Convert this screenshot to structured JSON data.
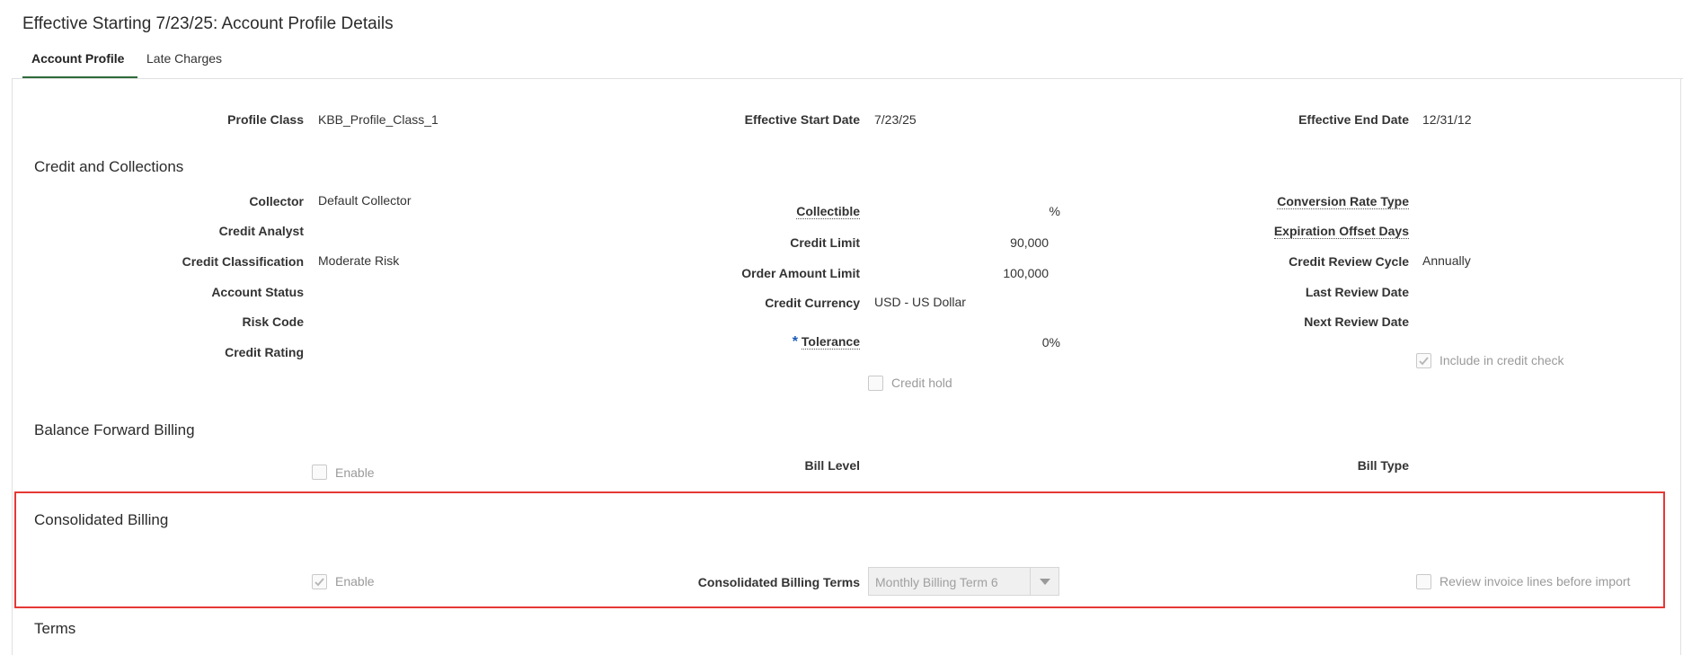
{
  "page": {
    "title": "Effective Starting 7/23/25: Account Profile Details"
  },
  "tabs": [
    {
      "label": "Account Profile",
      "active": true
    },
    {
      "label": "Late Charges",
      "active": false
    }
  ],
  "header_fields": {
    "profile_class_label": "Profile Class",
    "profile_class_value": "KBB_Profile_Class_1",
    "effective_start_label": "Effective Start Date",
    "effective_start_value": "7/23/25",
    "effective_end_label": "Effective End Date",
    "effective_end_value": "12/31/12"
  },
  "credit": {
    "title": "Credit and Collections",
    "collector_label": "Collector",
    "collector_value": "Default Collector",
    "credit_analyst_label": "Credit Analyst",
    "credit_classification_label": "Credit Classification",
    "credit_classification_value": "Moderate Risk",
    "account_status_label": "Account Status",
    "risk_code_label": "Risk Code",
    "credit_rating_label": "Credit Rating",
    "collectible_label": "Collectible",
    "collectible_value": "%",
    "credit_limit_label": "Credit Limit",
    "credit_limit_value": "90,000",
    "order_amount_limit_label": "Order Amount Limit",
    "order_amount_limit_value": "100,000",
    "credit_currency_label": "Credit Currency",
    "credit_currency_value": "USD - US Dollar",
    "tolerance_required": "*",
    "tolerance_label": "Tolerance",
    "tolerance_value": "0%",
    "credit_hold_label": "Credit hold",
    "conversion_rate_type_label": "Conversion Rate Type",
    "expiration_offset_days_label": "Expiration Offset Days",
    "credit_review_cycle_label": "Credit Review Cycle",
    "credit_review_cycle_value": "Annually",
    "last_review_date_label": "Last Review Date",
    "next_review_date_label": "Next Review Date",
    "include_credit_check_label": "Include in credit check"
  },
  "balance_forward": {
    "title": "Balance Forward Billing",
    "enable_label": "Enable",
    "bill_level_label": "Bill Level",
    "bill_type_label": "Bill Type"
  },
  "consolidated": {
    "title": "Consolidated Billing",
    "enable_label": "Enable",
    "terms_label": "Consolidated Billing Terms",
    "terms_value": "Monthly Billing Term 6",
    "review_lines_label": "Review invoice lines before import"
  },
  "terms": {
    "title": "Terms"
  },
  "colors": {
    "highlight": "#e53935",
    "tab_active": "#2e6b3a",
    "required": "#1a5ab8"
  }
}
